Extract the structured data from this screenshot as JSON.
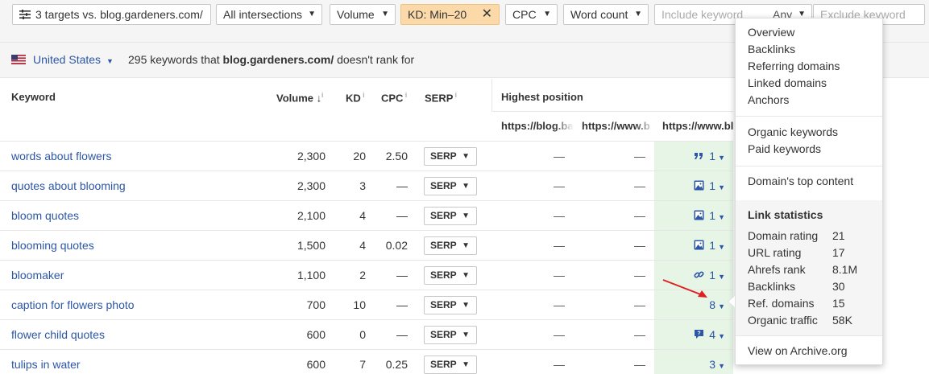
{
  "toolbar": {
    "targets": "3 targets vs. blog.gardeners.com/",
    "intersections": "All intersections",
    "volume": "Volume",
    "kd": "KD: Min–20",
    "cpc": "CPC",
    "word_count": "Word count",
    "include_placeholder": "Include keyword",
    "any": "Any",
    "exclude_placeholder": "Exclude keyword"
  },
  "subbar": {
    "country": "United States",
    "count": "295",
    "text_a": " keywords that ",
    "domain": "blog.gardeners.com/",
    "text_b": " doesn't rank for"
  },
  "table": {
    "headers": {
      "keyword": "Keyword",
      "volume": "Volume",
      "kd": "KD",
      "cpc": "CPC",
      "serp": "SERP",
      "highest": "Highest position"
    },
    "urls": [
      "https://blog.ba",
      "https://www.b",
      "https://www.bl"
    ],
    "rows": [
      {
        "keyword": "words about flowers",
        "volume": "2,300",
        "kd": "20",
        "cpc": "2.50",
        "serp": "SERP",
        "c1": "—",
        "c2": "—",
        "pos": "1",
        "icon": "quote-icon"
      },
      {
        "keyword": "quotes about blooming",
        "volume": "2,300",
        "kd": "3",
        "cpc": "—",
        "serp": "SERP",
        "c1": "—",
        "c2": "—",
        "pos": "1",
        "icon": "image-icon"
      },
      {
        "keyword": "bloom quotes",
        "volume": "2,100",
        "kd": "4",
        "cpc": "—",
        "serp": "SERP",
        "c1": "—",
        "c2": "—",
        "pos": "1",
        "icon": "image-icon"
      },
      {
        "keyword": "blooming quotes",
        "volume": "1,500",
        "kd": "4",
        "cpc": "0.02",
        "serp": "SERP",
        "c1": "—",
        "c2": "—",
        "pos": "1",
        "icon": "image-icon"
      },
      {
        "keyword": "bloomaker",
        "volume": "1,100",
        "kd": "2",
        "cpc": "—",
        "serp": "SERP",
        "c1": "—",
        "c2": "—",
        "pos": "1",
        "icon": "link-icon"
      },
      {
        "keyword": "caption for flowers photo",
        "volume": "700",
        "kd": "10",
        "cpc": "—",
        "serp": "SERP",
        "c1": "—",
        "c2": "—",
        "pos": "8",
        "icon": ""
      },
      {
        "keyword": "flower child quotes",
        "volume": "600",
        "kd": "0",
        "cpc": "—",
        "serp": "SERP",
        "c1": "—",
        "c2": "—",
        "pos": "4",
        "icon": "question-icon"
      },
      {
        "keyword": "tulips in water",
        "volume": "600",
        "kd": "7",
        "cpc": "0.25",
        "serp": "SERP",
        "c1": "—",
        "c2": "—",
        "pos": "3",
        "icon": ""
      }
    ]
  },
  "menu": {
    "group1": [
      "Overview",
      "Backlinks",
      "Referring domains",
      "Linked domains",
      "Anchors"
    ],
    "group2": [
      "Organic keywords",
      "Paid keywords"
    ],
    "group3": [
      "Domain's top content"
    ],
    "stats_title": "Link statistics",
    "stats": [
      {
        "label": "Domain rating",
        "value": "21"
      },
      {
        "label": "URL rating",
        "value": "17"
      },
      {
        "label": "Ahrefs rank",
        "value": "8.1M"
      },
      {
        "label": "Backlinks",
        "value": "30"
      },
      {
        "label": "Ref. domains",
        "value": "15"
      },
      {
        "label": "Organic traffic",
        "value": "58K"
      }
    ],
    "archive": "View on Archive.org"
  },
  "colors": {
    "link": "#2c56a6",
    "highlight": "#e6f5e6",
    "kd_filter": "#fbd9a9",
    "arrow": "#e02020"
  }
}
